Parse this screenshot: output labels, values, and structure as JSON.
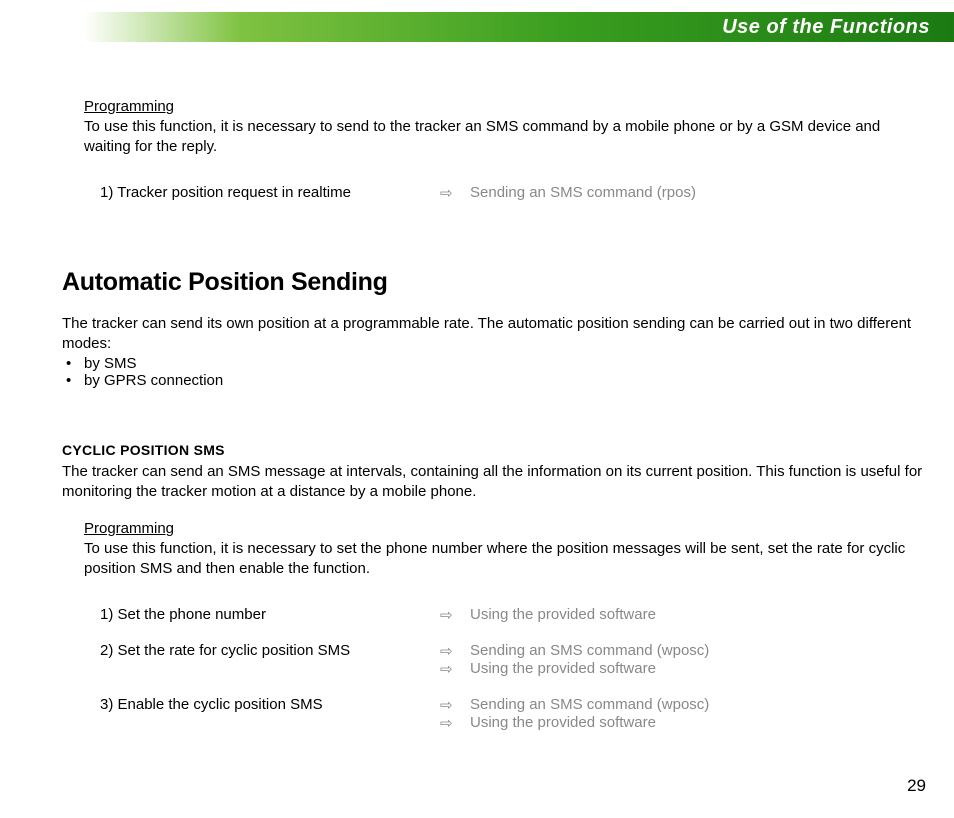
{
  "header": {
    "title": "Use of the Functions"
  },
  "prog1": {
    "label": "Programming",
    "text": "To use this function, it is necessary to send to the tracker an SMS command by a mobile phone or by a GSM device and waiting for the reply."
  },
  "step1": {
    "left": "1) Tracker position request in realtime",
    "right": "Sending an SMS command (rpos)"
  },
  "section_heading": "Automatic Position Sending",
  "intro": {
    "text": "The tracker can send its own position at a programmable rate. The automatic position sending can be carried out in two different modes:",
    "bullet1": "by SMS",
    "bullet2": "by GPRS connection"
  },
  "sub_heading": "CYCLIC POSITION SMS",
  "sub_text": "The tracker can send an SMS message at intervals, containing all the information on its current position. This function is useful for monitoring the tracker motion at a distance by a mobile phone.",
  "prog2": {
    "label": "Programming",
    "text": "To use this function, it is necessary to set the phone number where the position messages will be sent, set the rate for cyclic position SMS and then enable the function."
  },
  "steps2": {
    "s1_left": "1) Set the phone number",
    "s1_r1": "Using the provided software",
    "s2_left": "2) Set the rate for cyclic position SMS",
    "s2_r1": "Sending an SMS command (wposc)",
    "s2_r2": "Using the provided software",
    "s3_left": "3) Enable the cyclic position SMS",
    "s3_r1": "Sending an SMS command (wposc)",
    "s3_r2": "Using the provided software"
  },
  "arrow": "⇨",
  "page_number": "29"
}
